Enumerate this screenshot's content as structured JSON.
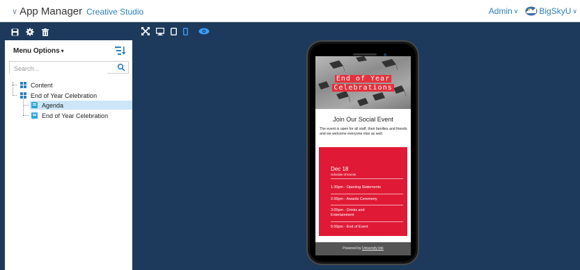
{
  "header": {
    "app_name": "App Manager",
    "app_subtitle": "Creative Studio",
    "admin_label": "Admin",
    "brand_label": "BigSkyU"
  },
  "toolbar": {
    "left_tools": [
      "save-icon",
      "gear-icon",
      "trash-icon"
    ],
    "view_tools": [
      "fullscreen-icon",
      "desktop-icon",
      "tablet-icon",
      "phone-icon",
      "preview-eye-icon"
    ]
  },
  "sidebar": {
    "menu_label": "Menu Options",
    "search_placeholder": "Search...",
    "tree": [
      {
        "label": "Content",
        "level": 0,
        "type": "folder"
      },
      {
        "label": "End of Year Celebration",
        "level": 0,
        "type": "folder"
      },
      {
        "label": "Agenda",
        "level": 1,
        "type": "page",
        "selected": true
      },
      {
        "label": "End of Year Celebration",
        "level": 1,
        "type": "page"
      }
    ]
  },
  "preview": {
    "hero_title_line1": "End of Year",
    "hero_title_line2": "Celebrations",
    "social_heading": "Join Our Social Event",
    "social_text": "The event is open for all staff, their families and friends and we welcome everyone else as well.",
    "date": "Dec 18",
    "schedule_label": "Schedule of Events",
    "schedule": [
      "1:30pm - Opening Statements",
      "2:00pm - Awards Ceremony",
      "3:00pm - Drinks and Entertainment",
      "5:00pm - End of Event"
    ],
    "powered_prefix": "Powered by",
    "powered_link": "University link"
  },
  "colors": {
    "workspace": "#1d3a5c",
    "accent_blue": "#2b7fc1",
    "event_red": "#e01a36",
    "selected_row": "#cce6f7"
  }
}
